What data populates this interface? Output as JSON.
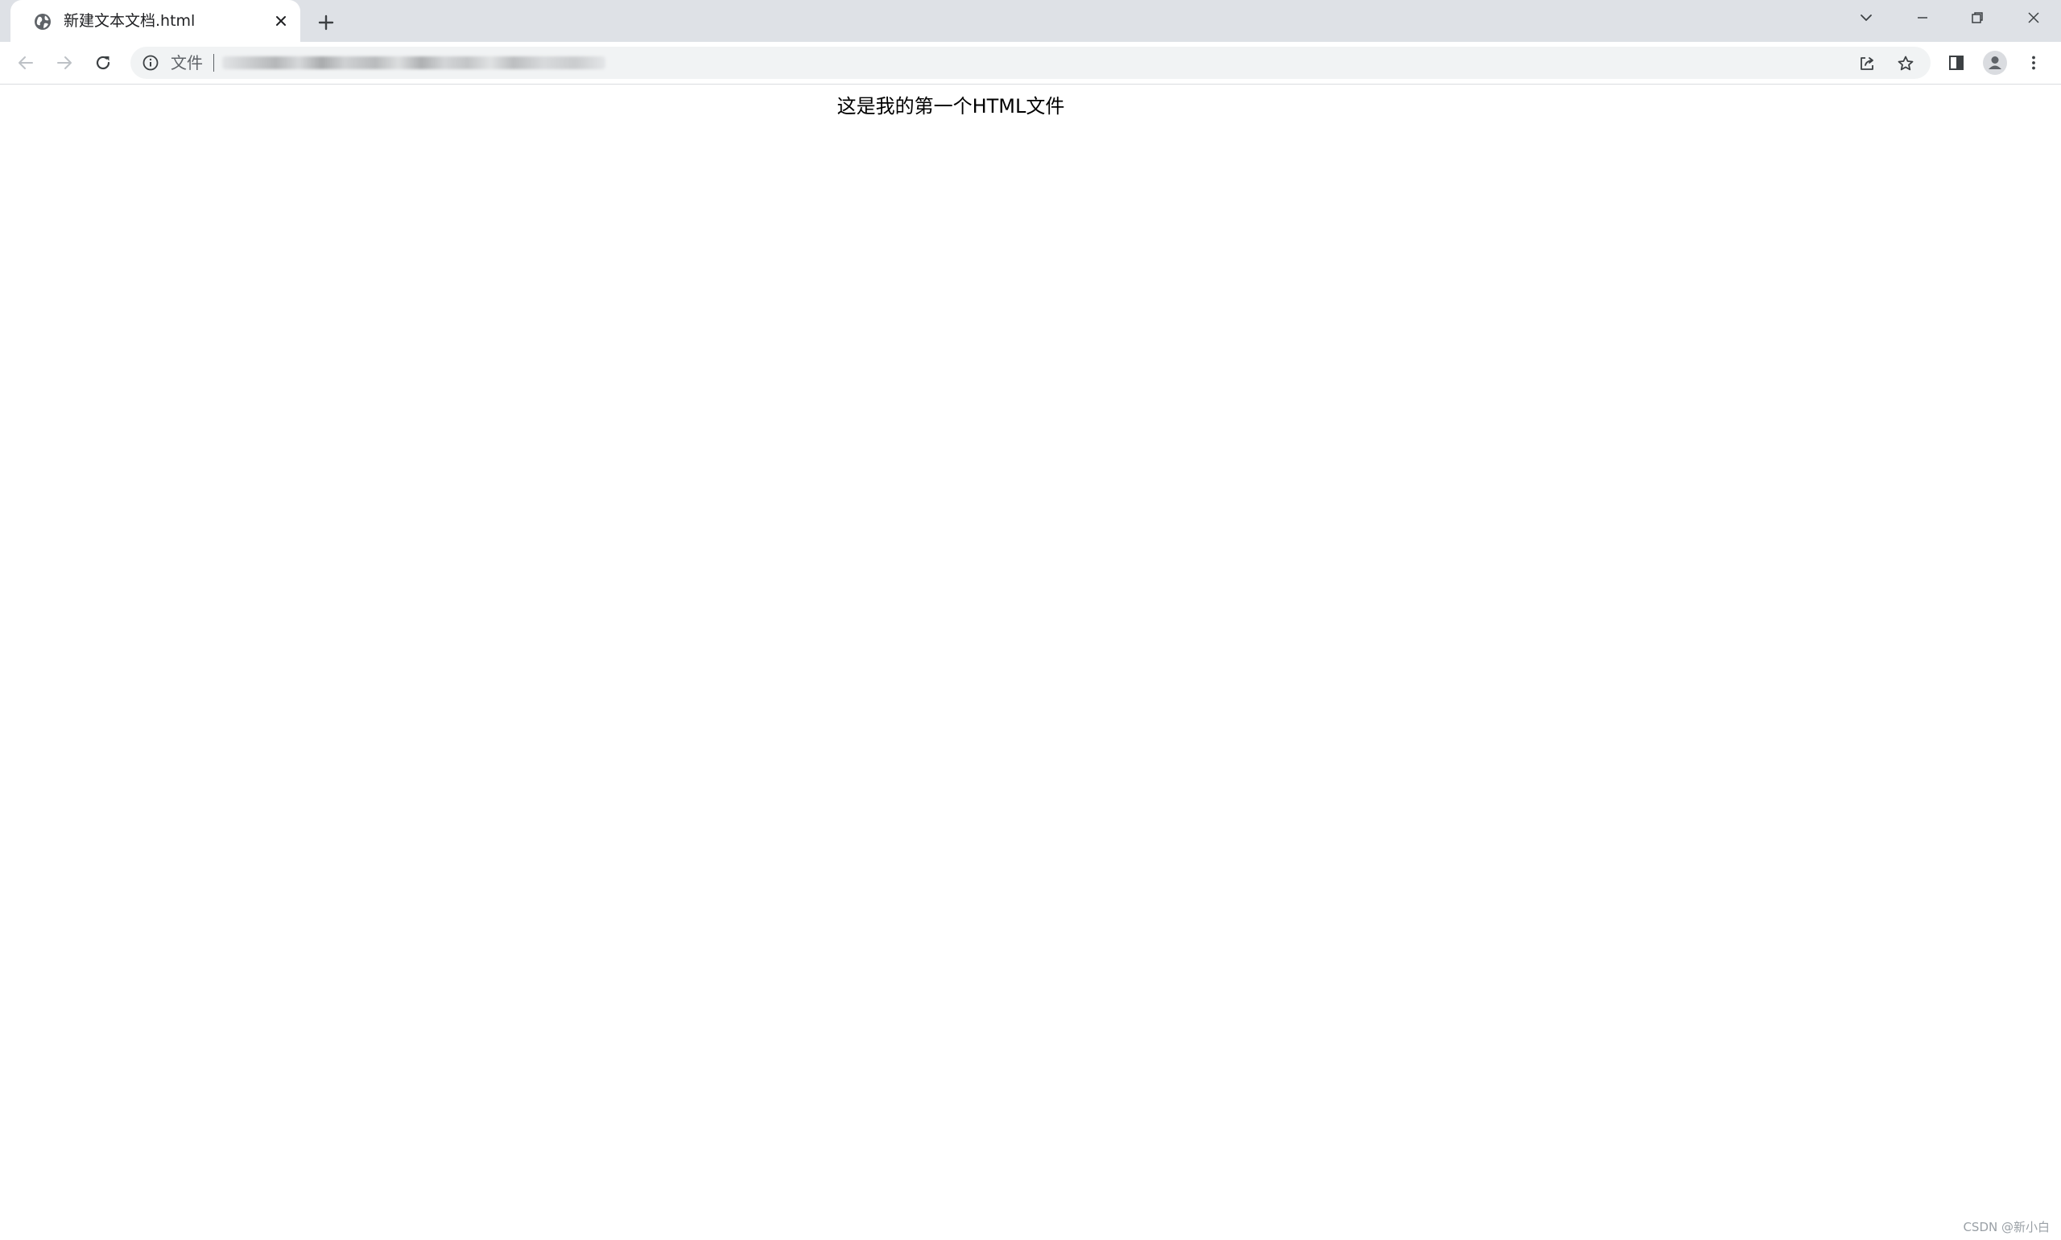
{
  "tab": {
    "title": "新建文本文档.html",
    "favicon": "globe-icon"
  },
  "omnibox": {
    "scheme_label": "文件",
    "url_redacted": true
  },
  "page": {
    "heading": "这是我的第一个HTML文件"
  },
  "watermark": "CSDN @新小白",
  "colors": {
    "tabstrip_bg": "#dee1e6",
    "omnibox_bg": "#f1f3f4",
    "icon": "#5f6368",
    "icon_disabled": "#bdc1c6",
    "text": "#202124"
  }
}
